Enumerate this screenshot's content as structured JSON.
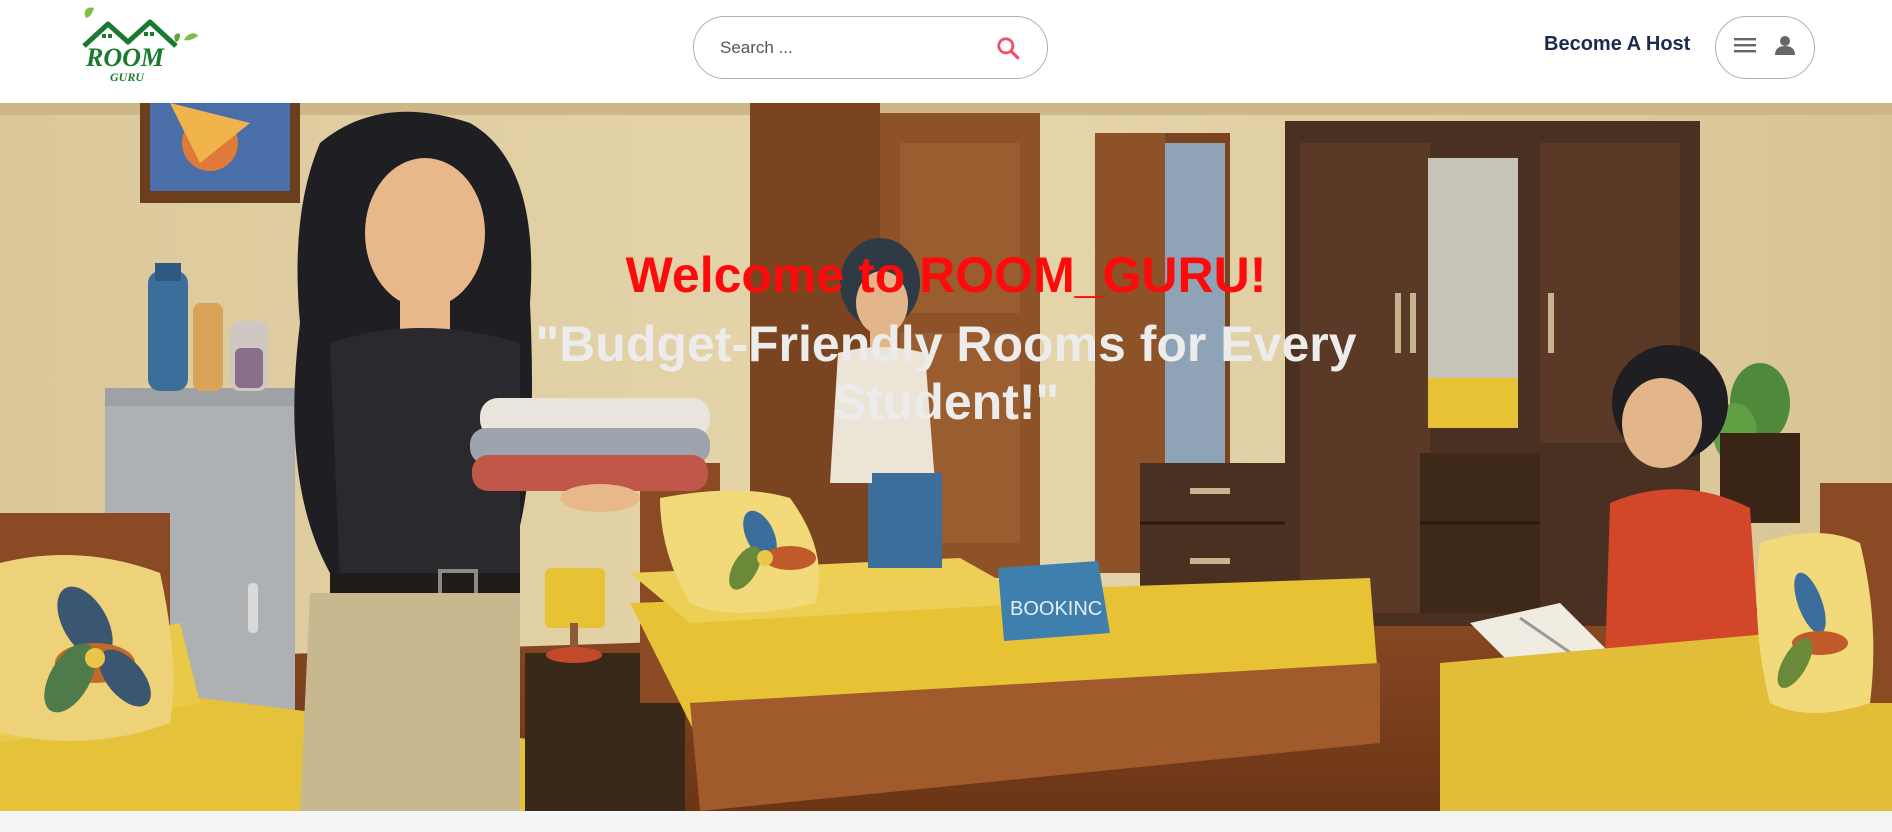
{
  "header": {
    "logo": {
      "word": "ROOM",
      "sub": "GURU"
    },
    "search": {
      "placeholder": "Search ..."
    },
    "host_link": "Become A Host"
  },
  "hero": {
    "title": "Welcome to ROOM_GURU!",
    "tagline": "\"Budget-Friendly Rooms for Every Student!\"",
    "sign_text": "BOOKINC"
  },
  "colors": {
    "title_red": "#ff0a0a",
    "search_pink": "#f0506e",
    "host_navy": "#1b2a4e",
    "logo_green": "#1a7a2e"
  }
}
